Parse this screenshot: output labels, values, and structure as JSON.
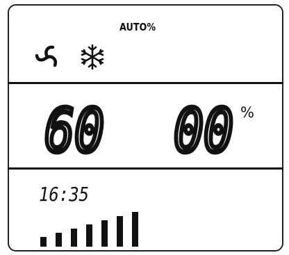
{
  "display": {
    "mode_label": "AUTO%",
    "setpoint": "60",
    "humidity": "00",
    "humidity_unit": "%",
    "clock": "16:35",
    "level": {
      "filled": 7,
      "total": 7
    }
  },
  "icons": {
    "fan": "fan-icon",
    "snowflake": "snowflake-icon"
  },
  "colors": {
    "segment": "#111111",
    "background": "#ffffff"
  }
}
